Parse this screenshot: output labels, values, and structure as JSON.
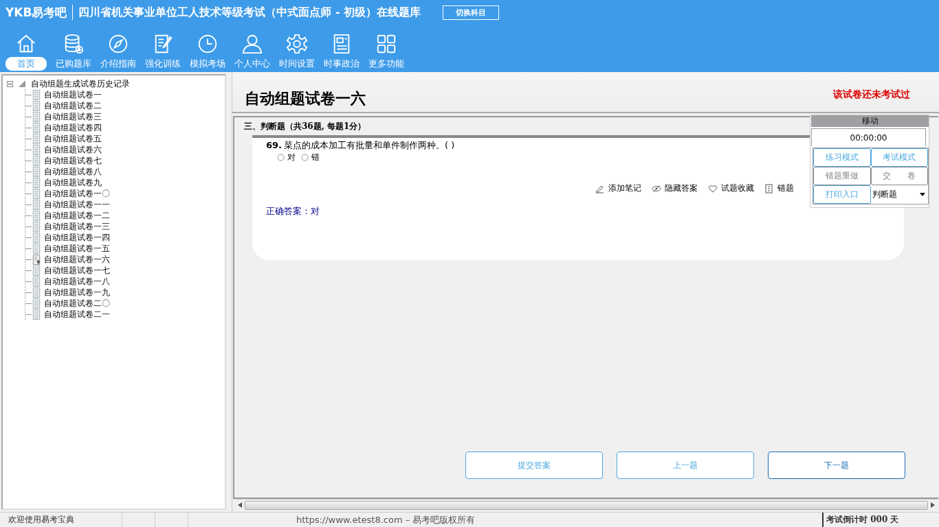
{
  "header": {
    "logo": "YKB易考吧",
    "title": "四川省机关事业单位工人技术等级考试（中式面点师 - 初级）在线题库",
    "switch_button": "切换科目"
  },
  "nav": [
    {
      "label": "首页",
      "selected": true
    },
    {
      "label": "已购题库",
      "selected": false
    },
    {
      "label": "介绍指南",
      "selected": false
    },
    {
      "label": "强化训练",
      "selected": false
    },
    {
      "label": "模拟考场",
      "selected": false
    },
    {
      "label": "个人中心",
      "selected": false
    },
    {
      "label": "时间设置",
      "selected": false
    },
    {
      "label": "时事政治",
      "selected": false
    },
    {
      "label": "更多功能",
      "selected": false
    }
  ],
  "tree": {
    "label": "自动组题生成试卷历史记录",
    "expanded": true,
    "children": [
      {
        "label": "自动组题试卷一",
        "current": false
      },
      {
        "label": "自动组题试卷二",
        "current": false
      },
      {
        "label": "自动组题试卷三",
        "current": false
      },
      {
        "label": "自动组题试卷四",
        "current": false
      },
      {
        "label": "自动组题试卷五",
        "current": false
      },
      {
        "label": "自动组题试卷六",
        "current": false
      },
      {
        "label": "自动组题试卷七",
        "current": false
      },
      {
        "label": "自动组题试卷八",
        "current": false
      },
      {
        "label": "自动组题试卷九",
        "current": false
      },
      {
        "label": "自动组题试卷一〇",
        "current": false
      },
      {
        "label": "自动组题试卷一一",
        "current": false
      },
      {
        "label": "自动组题试卷一二",
        "current": false
      },
      {
        "label": "自动组题试卷一三",
        "current": false
      },
      {
        "label": "自动组题试卷一四",
        "current": false
      },
      {
        "label": "自动组题试卷一五",
        "current": false
      },
      {
        "label": "自动组题试卷一六",
        "current": true
      },
      {
        "label": "自动组题试卷一七",
        "current": false
      },
      {
        "label": "自动组题试卷一八",
        "current": false
      },
      {
        "label": "自动组题试卷一九",
        "current": false
      },
      {
        "label": "自动组题试卷二〇",
        "current": false
      },
      {
        "label": "自动组题试卷二一",
        "current": false
      }
    ]
  },
  "paper": {
    "title": "自动组题试卷一六",
    "notice": "该试卷还未考试过"
  },
  "section": "三、判断题（共36题, 每题1分）",
  "question": {
    "number": "69.",
    "text": "菜点的成本加工有批量和单件制作两种。( )",
    "options": [
      {
        "label": "对",
        "selected": false
      },
      {
        "label": "错",
        "selected": false
      }
    ],
    "tools": [
      "添加笔记",
      "隐藏答案",
      "试题收藏",
      "错题"
    ],
    "answer": "正确答案：对"
  },
  "panel": {
    "handle": "移动",
    "timer": "00:00:00",
    "buttons": [
      {
        "label": "练习模式",
        "kind": "blue"
      },
      {
        "label": "考试模式",
        "kind": "blue"
      },
      {
        "label": "错题重做",
        "kind": "gray"
      },
      {
        "label": "交　　卷",
        "kind": "gray"
      },
      {
        "label": "打印入口",
        "kind": "blue"
      }
    ],
    "type_select": "判断题"
  },
  "actions": [
    "提交答案",
    "上一题",
    "下一题"
  ],
  "status_bar": {
    "welcome": "欢迎使用易考宝典",
    "copyright": "https://www.etest8.com – 易考吧版权所有",
    "countdown": "考试倒计时 000 天"
  }
}
